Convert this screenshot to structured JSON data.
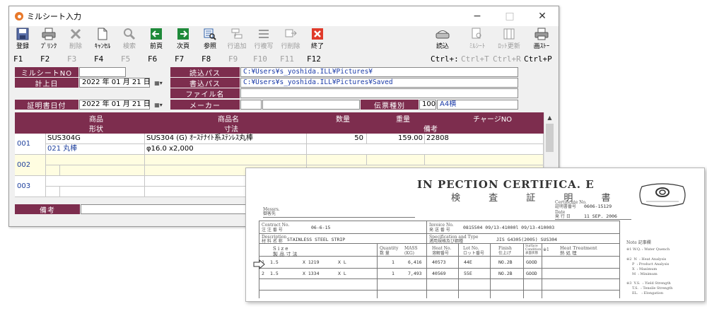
{
  "window": {
    "title": "ミルシート入力",
    "controls": {
      "minimize": "−",
      "maximize": "□",
      "close": "✕"
    }
  },
  "toolbar": {
    "buttons": [
      {
        "label": "登録",
        "icon": "save-icon",
        "enabled": true
      },
      {
        "label": "ﾌﾟﾘﾝｸ",
        "icon": "print-icon",
        "enabled": true
      },
      {
        "label": "削除",
        "icon": "delete-icon",
        "enabled": false
      },
      {
        "label": "ｷｬﾝｾﾙ",
        "icon": "cancel-icon",
        "enabled": true
      },
      {
        "label": "検索",
        "icon": "search-icon",
        "enabled": false
      },
      {
        "label": "前頁",
        "icon": "prev-page-icon",
        "enabled": true
      },
      {
        "label": "次頁",
        "icon": "next-page-icon",
        "enabled": true
      },
      {
        "label": "参照",
        "icon": "reference-icon",
        "enabled": true
      },
      {
        "label": "行追加",
        "icon": "add-row-icon",
        "enabled": false
      },
      {
        "label": "行複写",
        "icon": "copy-row-icon",
        "enabled": false
      },
      {
        "label": "行削除",
        "icon": "delete-row-icon",
        "enabled": false
      },
      {
        "label": "終了",
        "icon": "exit-icon",
        "enabled": true
      },
      {
        "label": "読込",
        "icon": "scanner-icon",
        "enabled": true
      },
      {
        "label": "ﾐﾙｼｰﾄ",
        "icon": "millsheet-icon",
        "enabled": false
      },
      {
        "label": "ﾛｯﾄ更新",
        "icon": "lot-update-icon",
        "enabled": false
      },
      {
        "label": "画ｽﾄｰ",
        "icon": "image-store-icon",
        "enabled": true
      }
    ],
    "fkeys": [
      {
        "label": "F1",
        "enabled": true
      },
      {
        "label": "F2",
        "enabled": true
      },
      {
        "label": "F3",
        "enabled": false
      },
      {
        "label": "F4",
        "enabled": true
      },
      {
        "label": "F5",
        "enabled": false
      },
      {
        "label": "F6",
        "enabled": true
      },
      {
        "label": "F7",
        "enabled": true
      },
      {
        "label": "F8",
        "enabled": true
      },
      {
        "label": "F9",
        "enabled": false
      },
      {
        "label": "F10",
        "enabled": false
      },
      {
        "label": "F11",
        "enabled": false
      },
      {
        "label": "F12",
        "enabled": true
      },
      {
        "label": "Ctrl+:",
        "enabled": true
      },
      {
        "label": "Ctrl+T",
        "enabled": false
      },
      {
        "label": "Ctrl+R",
        "enabled": false
      },
      {
        "label": "Ctrl+P",
        "enabled": true
      }
    ]
  },
  "form": {
    "millsheet_no_label": "ミルシートNO",
    "millsheet_no_value": "",
    "posting_date_label": "計上日",
    "posting_date_value": "2022 年 01 月 21 日",
    "cert_date_label": "証明書日付",
    "cert_date_value": "2022 年 01 月 21 日",
    "date_button": "▦▾",
    "read_path_label": "読込パス",
    "read_path_value": "C:¥Users¥s_yoshida.ILL¥Pictures¥",
    "write_path_label": "書込パス",
    "write_path_value": "C:¥Users¥s_yoshida.ILL¥Pictures¥Saved",
    "file_name_label": "ファイル名",
    "file_name_value": "",
    "maker_label": "メーカー",
    "maker_code": "",
    "maker_name": "",
    "slip_type_label": "伝票種別",
    "slip_type_code": "100",
    "slip_type_name": "A4横",
    "remarks_label": "備考",
    "remarks_value": ""
  },
  "grid": {
    "header_row1": {
      "product": "商品",
      "product_name": "商品名",
      "qty": "数量",
      "weight": "重量",
      "charge_no": "チャージNO"
    },
    "header_row2": {
      "shape": "形状",
      "dimensions": "寸法",
      "remarks": "備考"
    },
    "rows": [
      {
        "no": "001",
        "product": "SUS304G",
        "shape": "021 丸棒",
        "product_name": "SUS304 (G) ｵｰｽﾃﾅｲﾄ系ｽﾃﾝﾚｽ丸棒",
        "dimensions": "φ16.0 x2,000",
        "qty": "50",
        "weight": "159.00",
        "charge_no": "22808",
        "remarks": ""
      },
      {
        "no": "002",
        "product": "",
        "shape": "",
        "product_name": "",
        "dimensions": "",
        "qty": "",
        "weight": "",
        "charge_no": "",
        "remarks": ""
      },
      {
        "no": "003",
        "product": "",
        "shape": "",
        "product_name": "",
        "dimensions": "",
        "qty": "",
        "weight": "",
        "charge_no": "",
        "remarks": ""
      }
    ],
    "scroll_up": "▲",
    "scroll_down": "▼"
  },
  "certificate": {
    "title": "IN PECTION CERTIFICA. E",
    "title_jp": "検 査 証 明 書",
    "cert_no_label": "Certificate No.\n証明書番号",
    "cert_no_value": "0606-15129",
    "date_label": "Date\n発 行 日",
    "date_value": "11 SEP. 2006",
    "maker_label": "Messrs.\n御客先",
    "contract_no_label": "Contract No.\n注 注 番 号",
    "contract_no_value": "06-6-15",
    "invoice_no_label": "Invoice No.\n発 送 番 号",
    "invoice_no_value": "0815504   09/13-41000l 09/13-410003",
    "description_label": "Description\n材 料 名 称",
    "description_value": "STAINLESS STEEL STRIP",
    "spec_label": "Specification and Type\n適用規格及び鋼種",
    "spec_value": "JIS  G4305(2005)  SUS304",
    "size_label": "S i z e\n製 品 寸 法",
    "qty_label": "Quantity\n数 量",
    "mass_label": "MASS\n(KG)",
    "heat_label": "Heat No.\n溶解番号",
    "lot_label": "Lot No.\nロット番号",
    "finish_label": "Finish\n仕上げ",
    "surface_label": "Surface\nCondition\n表面状態",
    "heat_treat_label": "Heat Treatment\n熱 処 理",
    "heat_treat_no": "※1",
    "note_label": "Note 記事欄",
    "notes": [
      "※1  W.Q. : Water Quench",
      "※2  N  : Heat Analysis",
      "     P  : Product Analysis",
      "     X  : Maximum",
      "     M  : Minimum",
      "※3  Y.S.  : Yield Strength",
      "     T.S.  : Tensile Strength",
      "     EL.   : Elongation"
    ],
    "rows": [
      {
        "no": "1",
        "t": "1.5",
        "w": "X 1219",
        "l": "X L",
        "qty": "1",
        "mass": "6,416",
        "heat": "40573",
        "lot": "44E",
        "finish": "NO.2B",
        "surface": "GOOD"
      },
      {
        "no": "2",
        "t": "1.5",
        "w": "X 1334",
        "l": "X L",
        "qty": "1",
        "mass": "7,493",
        "heat": "40569",
        "lot": "55E",
        "finish": "NO.2B",
        "surface": "GOOD"
      }
    ]
  }
}
